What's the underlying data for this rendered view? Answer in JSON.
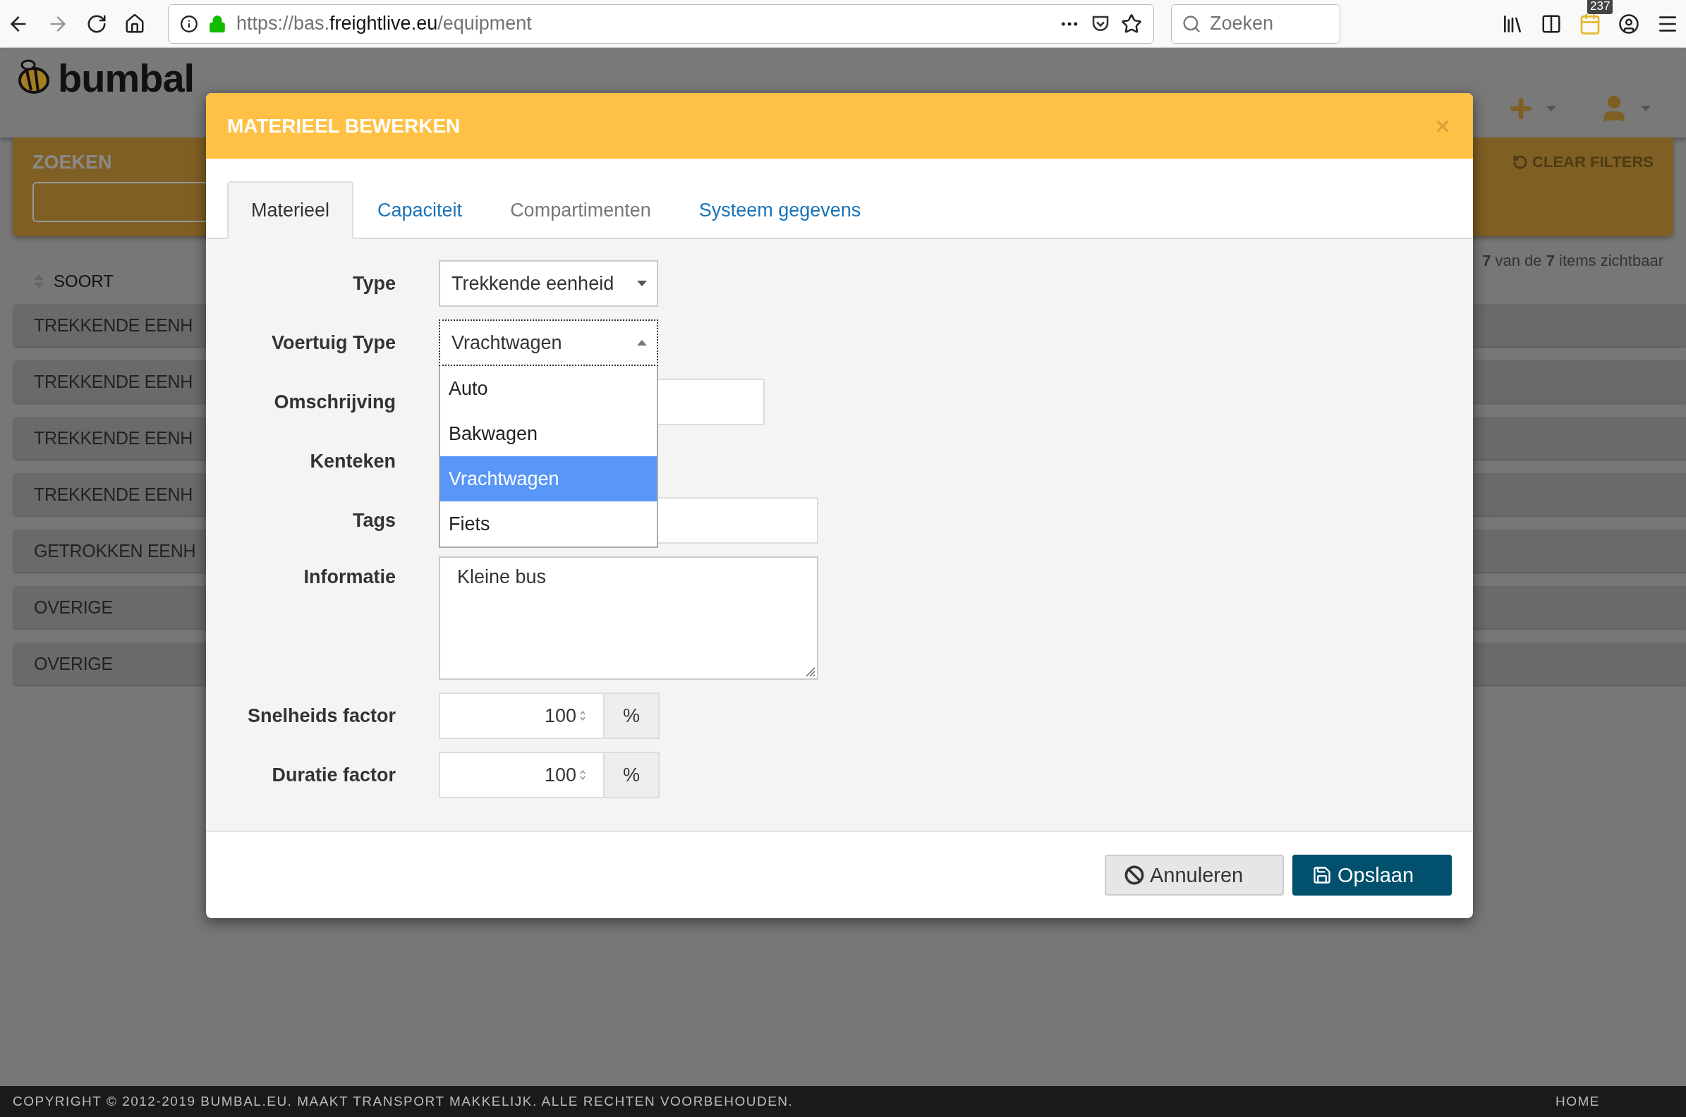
{
  "browser": {
    "url_prefix": "https://bas.",
    "url_domain": "freightlive.eu",
    "url_path": "/equipment",
    "search_placeholder": "Zoeken",
    "badge": "237"
  },
  "app": {
    "logo": "bumbal",
    "search_label": "ZOEKEN",
    "clear_filters": "CLEAR FILTERS",
    "count_text": "**7** van de **7** items zichtbaar",
    "sort_label": "SOORT",
    "rows": [
      "TREKKENDE EENH",
      "TREKKENDE EENH",
      "TREKKENDE EENH",
      "TREKKENDE EENH",
      "GETROKKEN EENH",
      "OVERIGE",
      "OVERIGE"
    ]
  },
  "modal": {
    "title": "MATERIEEL BEWERKEN",
    "tabs": [
      {
        "label": "Materieel",
        "selected": true,
        "disabled": false
      },
      {
        "label": "Capaciteit",
        "selected": false,
        "disabled": false
      },
      {
        "label": "Compartimenten",
        "selected": false,
        "disabled": true
      },
      {
        "label": "Systeem gegevens",
        "selected": false,
        "disabled": false
      }
    ],
    "fields": [
      {
        "kind": "select",
        "label": "Type",
        "value": "Trekkende eenheid",
        "open": false
      },
      {
        "kind": "select",
        "label": "Voertuig Type",
        "value": "Vrachtwagen",
        "open": true,
        "options": [
          {
            "label": "Auto",
            "selected": false
          },
          {
            "label": "Bakwagen",
            "selected": false
          },
          {
            "label": "Vrachtwagen",
            "selected": true
          },
          {
            "label": "Fiets",
            "selected": false
          }
        ]
      },
      {
        "kind": "short-text",
        "label": "Omschrijving"
      },
      {
        "kind": "hidden",
        "label": "Kenteken"
      },
      {
        "kind": "long-text",
        "label": "Tags"
      },
      {
        "kind": "textarea",
        "label": "Informatie",
        "value": "Kleine bus"
      },
      {
        "kind": "number",
        "label": "Snelheids factor",
        "value": "100",
        "unit": "%"
      },
      {
        "kind": "number",
        "label": "Duratie factor",
        "value": "100",
        "unit": "%"
      }
    ],
    "cancel": "Annuleren",
    "save": "Opslaan"
  },
  "footer": {
    "copyright": "COPYRIGHT © 2012-2019 BUMBAL.EU. MAAKT TRANSPORT MAKKELIJK. ALLE RECHTEN VOORBEHOUDEN.",
    "home": "HOME"
  }
}
